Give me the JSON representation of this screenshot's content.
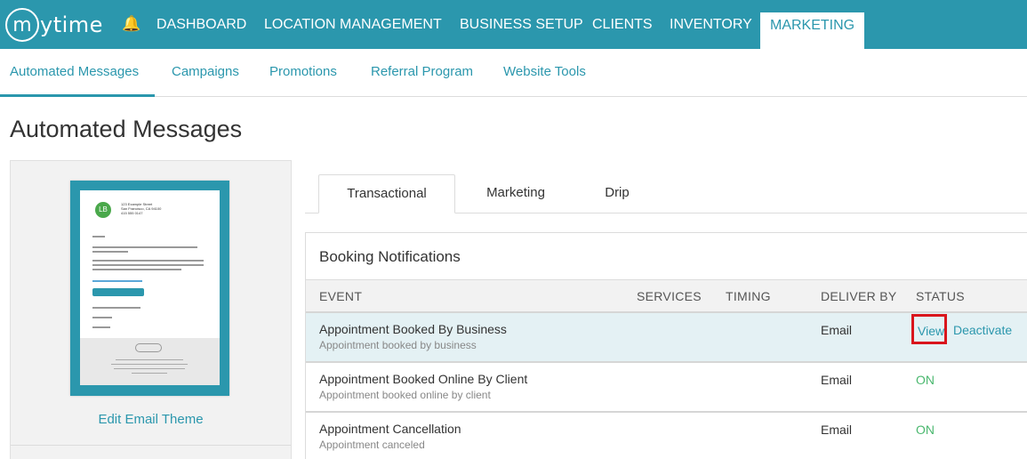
{
  "brand": {
    "logo_letter": "m",
    "logo_text": "ytime"
  },
  "topnav": {
    "items": [
      "DASHBOARD",
      "LOCATION MANAGEMENT",
      "BUSINESS SETUP",
      "CLIENTS",
      "INVENTORY",
      "MARKETING"
    ],
    "active": "MARKETING"
  },
  "subnav": {
    "items": [
      "Automated Messages",
      "Campaigns",
      "Promotions",
      "Referral Program",
      "Website Tools"
    ],
    "active": "Automated Messages"
  },
  "page_title": "Automated Messages",
  "left_panel": {
    "edit_theme_label": "Edit Email Theme",
    "thumbnail": {
      "logo_letters": "LB",
      "address": [
        "123 Example Street",
        "San Francisco, CA 94100",
        "415 555 0147"
      ]
    }
  },
  "tabs": [
    "Transactional",
    "Marketing",
    "Drip"
  ],
  "active_tab": "Transactional",
  "card": {
    "title": "Booking Notifications",
    "columns": [
      "EVENT",
      "SERVICES",
      "TIMING",
      "DELIVER BY",
      "STATUS"
    ],
    "rows": [
      {
        "name": "Appointment Booked By Business",
        "sub": "Appointment booked by business",
        "deliver": "Email",
        "status": "",
        "actions": [
          "View",
          "Deactivate"
        ],
        "highlighted": true
      },
      {
        "name": "Appointment Booked Online By Client",
        "sub": "Appointment booked online by client",
        "deliver": "Email",
        "status": "ON",
        "actions": [],
        "highlighted": false
      },
      {
        "name": "Appointment Cancellation",
        "sub": "Appointment canceled",
        "deliver": "Email",
        "status": "ON",
        "actions": [],
        "highlighted": false
      }
    ]
  },
  "colors": {
    "brand": "#2b97ad",
    "status_on": "#4bb86f",
    "highlight_border": "#d9151c"
  }
}
